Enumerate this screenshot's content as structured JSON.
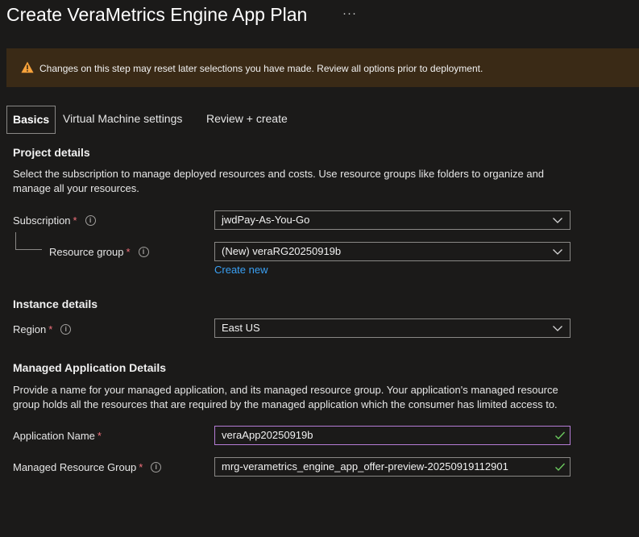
{
  "page": {
    "title": "Create VeraMetrics Engine App Plan",
    "more_label": "···"
  },
  "banner": {
    "icon": "warning-icon",
    "text": "Changes on this step may reset later selections you have made. Review all options prior to deployment."
  },
  "tabs": [
    {
      "label": "Basics",
      "active": true
    },
    {
      "label": "Virtual Machine settings",
      "active": false
    },
    {
      "label": "Review + create",
      "active": false
    }
  ],
  "project": {
    "heading": "Project details",
    "description": "Select the subscription to manage deployed resources and costs. Use resource groups like folders to organize and manage all your resources.",
    "subscription_label": "Subscription",
    "subscription_value": "jwdPay-As-You-Go",
    "resource_group_label": "Resource group",
    "resource_group_value": "(New) veraRG20250919b",
    "create_new": "Create new"
  },
  "instance": {
    "heading": "Instance details",
    "region_label": "Region",
    "region_value": "East US"
  },
  "managed": {
    "heading": "Managed Application Details",
    "description": "Provide a name for your managed application, and its managed resource group. Your application's managed resource group holds all the resources that are required by the managed application which the consumer has limited access to.",
    "app_name_label": "Application Name",
    "app_name_value": "veraApp20250919b",
    "mrg_label": "Managed Resource Group",
    "mrg_value": "mrg-verametrics_engine_app_offer-preview-20250919112901"
  },
  "common": {
    "required_mark": "*",
    "info_glyph": "i"
  },
  "colors": {
    "accent": "#3aa0f3",
    "required": "#f1707b",
    "valid": "#6ccb5f",
    "warning": "#fce100",
    "focus": "#b57cd6"
  }
}
